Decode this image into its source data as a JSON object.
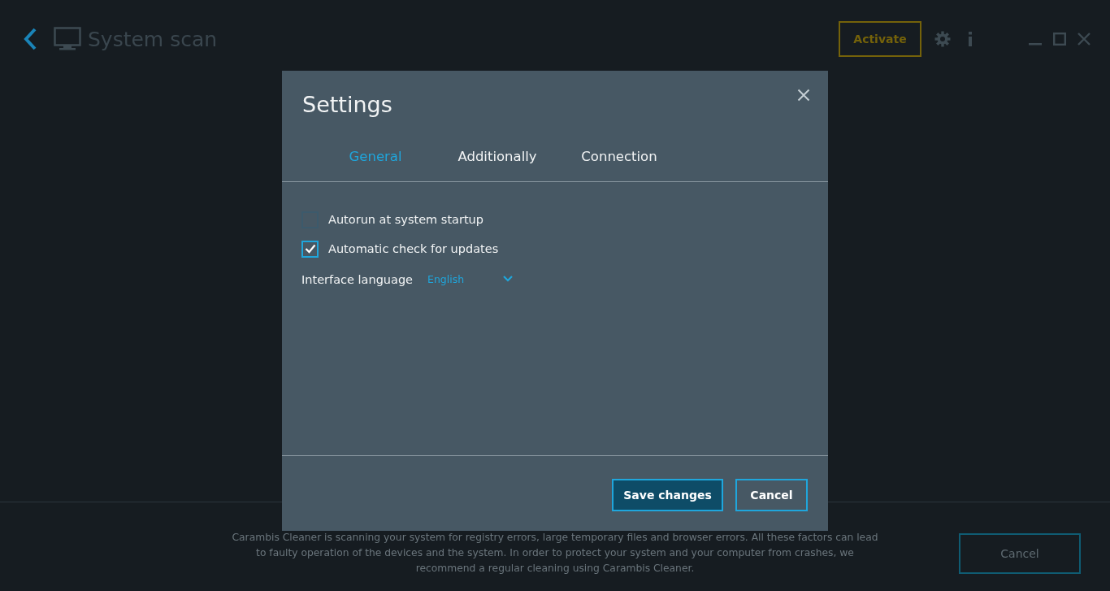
{
  "header": {
    "title": "System scan",
    "activate_button": "Activate"
  },
  "footer": {
    "text": "Carambis Cleaner is scanning your system for registry errors, large temporary files and browser errors. All these factors can lead to faulty operation of the devices and the system. In order to protect your system and your computer from crashes, we recommend a regular cleaning using Carambis Cleaner.",
    "button": "Cancel"
  },
  "dialog": {
    "title": "Settings",
    "tabs": [
      {
        "label": "General",
        "selected": true
      },
      {
        "label": "Additionally",
        "selected": false
      },
      {
        "label": "Connection",
        "selected": false
      }
    ],
    "options": [
      {
        "label": "Autorun at system startup",
        "checked": false
      },
      {
        "label": "Automatic check for updates",
        "checked": true
      }
    ],
    "language": {
      "label": "Interface language",
      "value": "English"
    },
    "buttons": [
      {
        "label": "Save changes",
        "kind": "primary"
      },
      {
        "label": "Cancel",
        "kind": "secondary"
      }
    ]
  }
}
